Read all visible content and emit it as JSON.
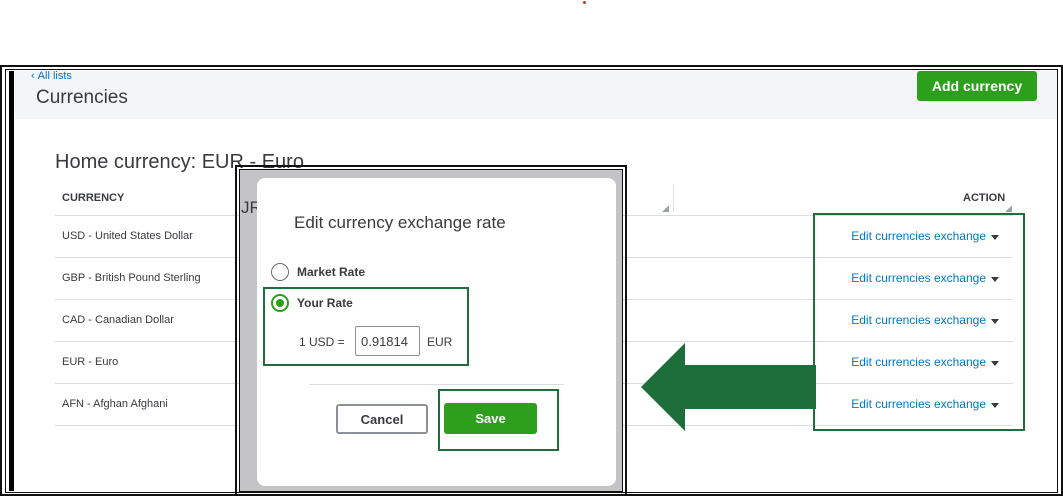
{
  "header": {
    "back_link": "All lists",
    "title": "Currencies",
    "add_button": "Add currency"
  },
  "home_currency": "Home currency: EUR - Euro",
  "table": {
    "columns": {
      "currency": "CURRENCY",
      "action": "ACTION"
    },
    "rows": [
      {
        "currency": "USD - United States Dollar",
        "action": "Edit currencies exchange"
      },
      {
        "currency": "GBP - British Pound Sterling",
        "action": "Edit currencies exchange"
      },
      {
        "currency": "CAD - Canadian Dollar",
        "action": "Edit currencies exchange"
      },
      {
        "currency": "EUR - Euro",
        "action": "Edit currencies exchange"
      },
      {
        "currency": "AFN - Afghan Afghani",
        "action": "Edit currencies exchange"
      }
    ]
  },
  "modal": {
    "title": "Edit currency exchange rate",
    "options": [
      {
        "label": "Market Rate",
        "selected": false
      },
      {
        "label": "Your Rate",
        "selected": true
      }
    ],
    "rate_prefix": "1 USD =",
    "rate_value": "0.91814",
    "rate_unit": "EUR",
    "cancel": "Cancel",
    "save": "Save"
  },
  "colors": {
    "accent_green": "#2ca01c",
    "link_blue": "#0077c5",
    "annotation_green": "#1e6e3b"
  },
  "icons": {
    "back": "chevron-left-icon",
    "row_menu": "caret-down-icon",
    "callout": "arrow-left-icon"
  }
}
